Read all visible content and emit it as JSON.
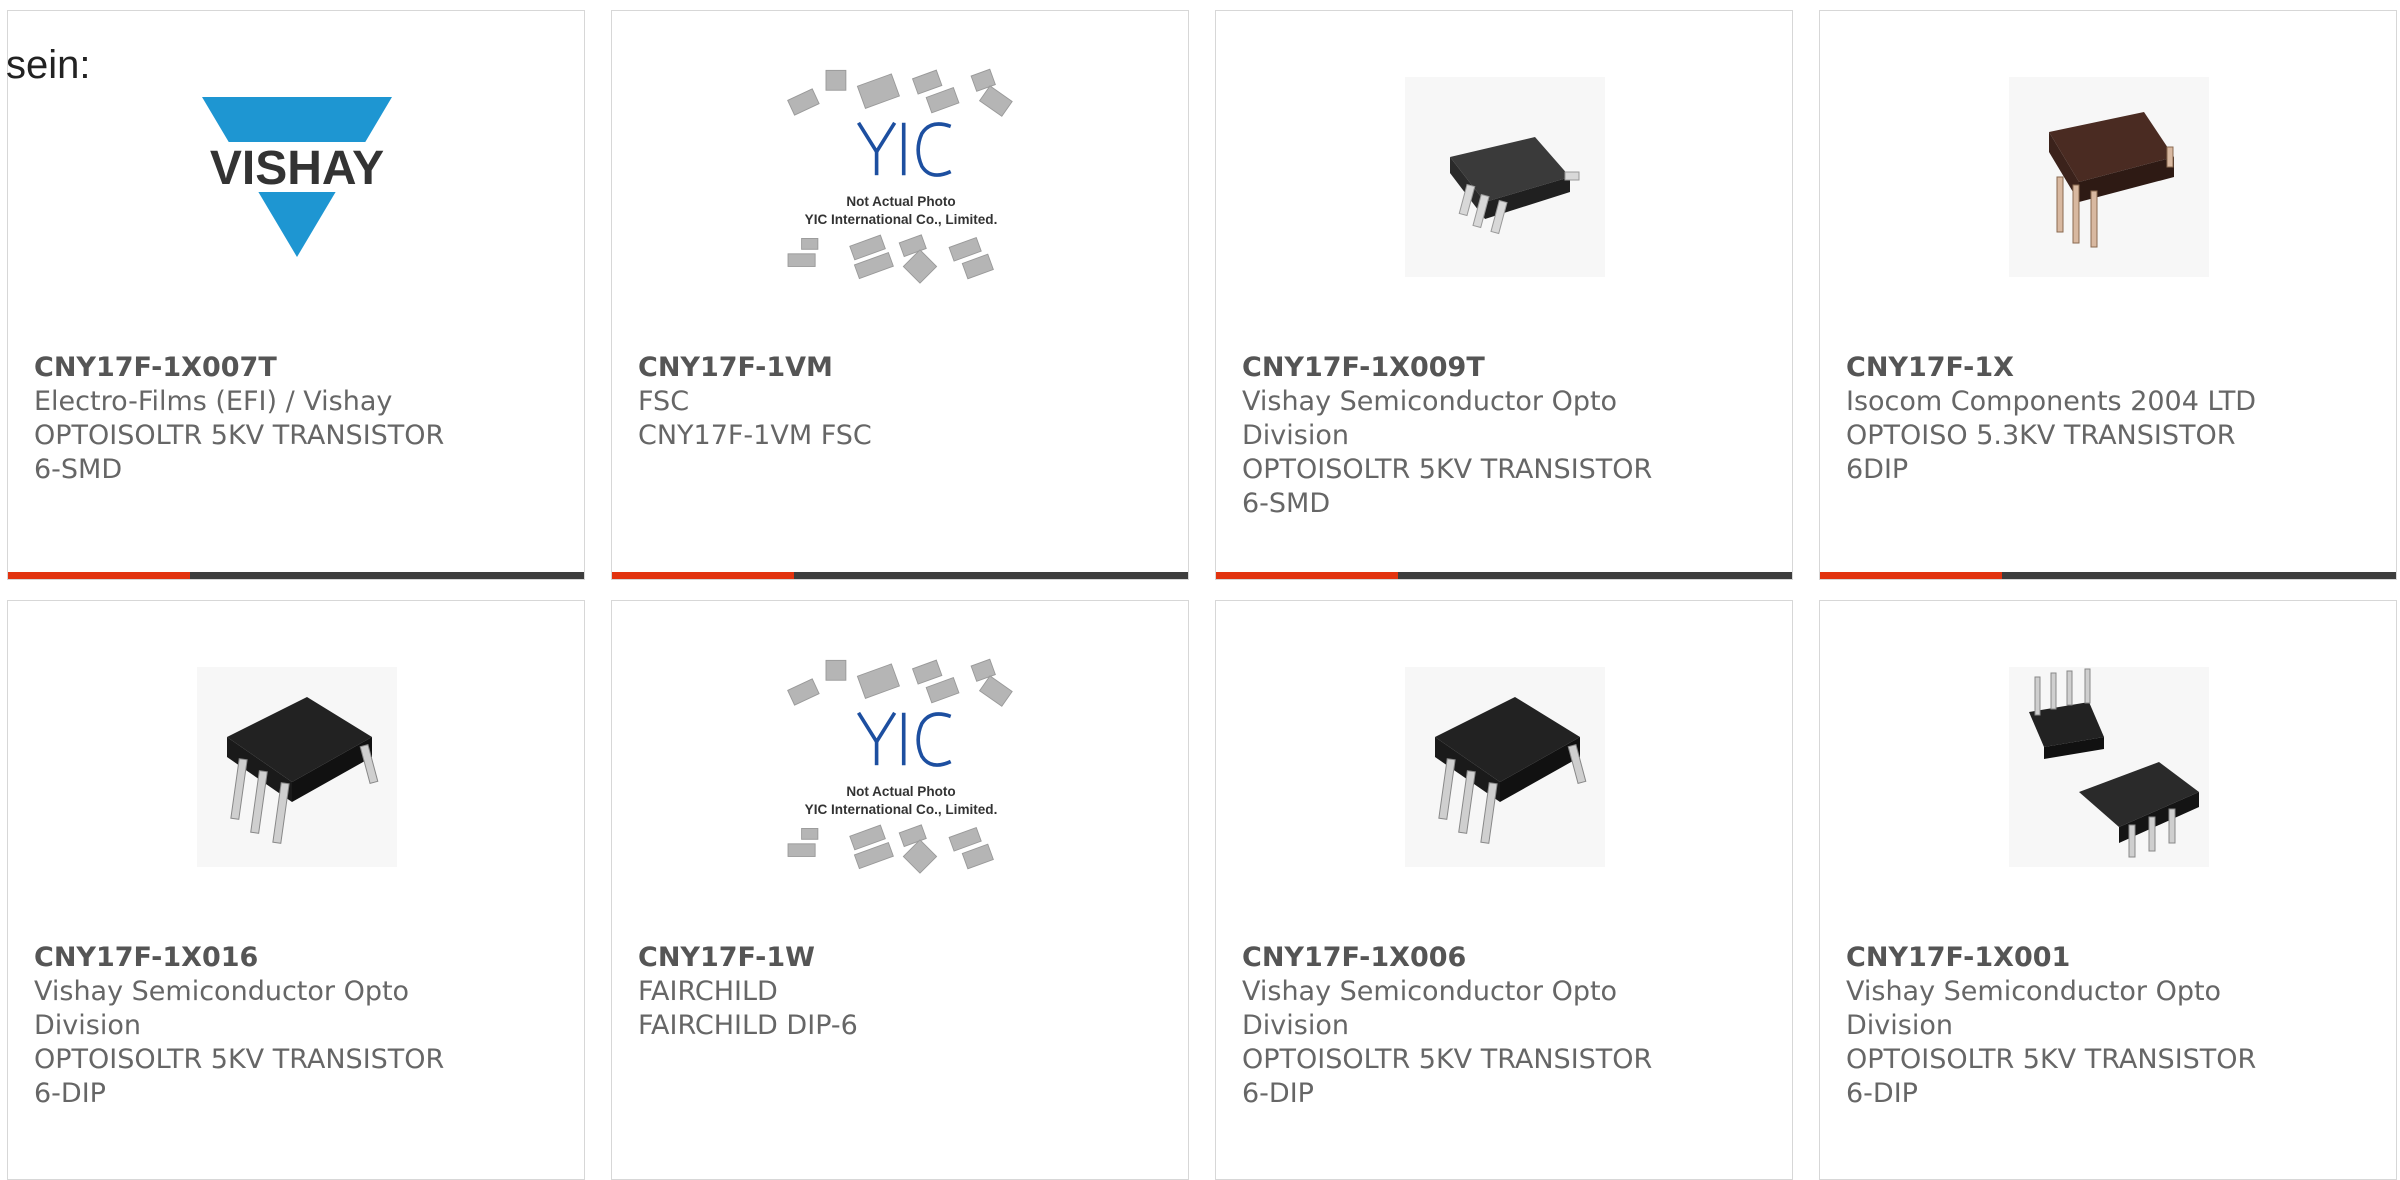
{
  "intro_text": "sein:",
  "colors": {
    "accent_red": "#e2330f",
    "bar_dark": "#3d3d3d",
    "text": "#666666",
    "vishay_blue": "#1e96d2"
  },
  "placeholder": {
    "line1": "Not Actual Photo",
    "line2": "YIC International Co., Limited."
  },
  "vishay_logo_text": "VISHAY",
  "products": [
    {
      "part": "CNY17F-1X007T",
      "manufacturer": "Electro-Films (EFI) / Vishay",
      "desc_line1": "OPTOISOLTR 5KV TRANSISTOR",
      "desc_line2": "6-SMD",
      "image": "vishay-logo-icon"
    },
    {
      "part": "CNY17F-1VM",
      "manufacturer": "FSC",
      "desc_line1": "CNY17F-1VM FSC",
      "desc_line2": "",
      "image": "not-actual-photo-icon"
    },
    {
      "part": "CNY17F-1X009T",
      "manufacturer": "Vishay Semiconductor Opto",
      "manufacturer_line2": "Division",
      "desc_line1": "OPTOISOLTR 5KV TRANSISTOR",
      "desc_line2": "6-SMD",
      "image": "smd-chip-icon"
    },
    {
      "part": "CNY17F-1X",
      "manufacturer": "Isocom Components 2004 LTD",
      "desc_line1": "OPTOISO 5.3KV TRANSISTOR",
      "desc_line2": "6DIP",
      "image": "dip-chip-brown-icon"
    },
    {
      "part": "CNY17F-1X016",
      "manufacturer": "Vishay Semiconductor Opto",
      "manufacturer_line2": "Division",
      "desc_line1": "OPTOISOLTR 5KV TRANSISTOR",
      "desc_line2": "6-DIP",
      "image": "dip-chip-icon"
    },
    {
      "part": "CNY17F-1W",
      "manufacturer": "FAIRCHILD",
      "desc_line1": "FAIRCHILD DIP-6",
      "desc_line2": "",
      "image": "not-actual-photo-icon"
    },
    {
      "part": "CNY17F-1X006",
      "manufacturer": "Vishay Semiconductor Opto",
      "manufacturer_line2": "Division",
      "desc_line1": "OPTOISOLTR 5KV TRANSISTOR",
      "desc_line2": "6-DIP",
      "image": "dip-chip-icon"
    },
    {
      "part": "CNY17F-1X001",
      "manufacturer": "Vishay Semiconductor Opto",
      "manufacturer_line2": "Division",
      "desc_line1": "OPTOISOLTR 5KV TRANSISTOR",
      "desc_line2": "6-DIP",
      "image": "dip-chip-pair-icon"
    }
  ]
}
